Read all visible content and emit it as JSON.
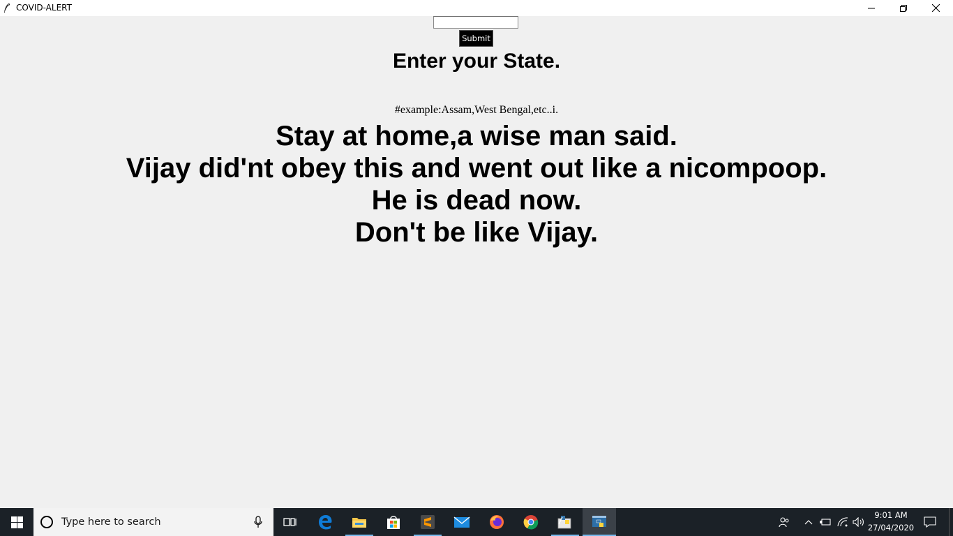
{
  "window": {
    "title": "COVID-ALERT",
    "controls": {
      "minimize": "minimize-icon",
      "restore": "restore-icon",
      "close": "close-icon"
    }
  },
  "form": {
    "state_input_value": "",
    "submit_label": "Submit"
  },
  "content": {
    "heading": "Enter your State.",
    "example": "#example:Assam,West Bengal,etc..i.",
    "message_lines": [
      "Stay at home,a wise man said.",
      "Vijay did'nt obey this and went out like a nicompoop.",
      "He is dead now.",
      "Don't be like Vijay."
    ]
  },
  "taskbar": {
    "search_placeholder": "Type here to search",
    "pinned_apps": [
      "task-view-icon",
      "edge-icon",
      "file-explorer-icon",
      "store-icon",
      "sublime-text-icon",
      "mail-icon",
      "firefox-icon",
      "chrome-icon",
      "python-idle-icon",
      "python-app-icon"
    ],
    "clock_time": "9:01 AM",
    "clock_date": "27/04/2020"
  },
  "colors": {
    "window_bg": "#f0f0f0",
    "button_bg": "#000000",
    "taskbar_bg": "#1b2127",
    "active_underline": "#76b9ed"
  }
}
